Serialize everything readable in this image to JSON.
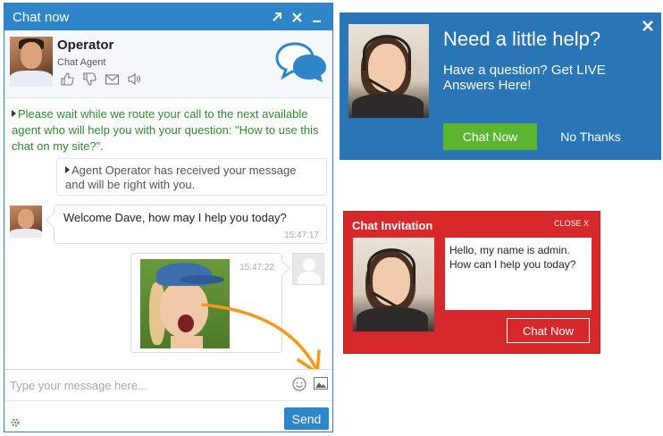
{
  "chat_window": {
    "title": "Chat now",
    "controls": {
      "popout_icon": "arrow-up-right-icon",
      "close_icon": "close-icon",
      "minimize_icon": "minimize-icon"
    },
    "operator": {
      "name": "Operator",
      "role": "Chat Agent",
      "actions": [
        "thumbs-up-icon",
        "thumbs-down-icon",
        "envelope-icon",
        "speaker-icon"
      ],
      "brand_icon": "chat-bubbles-icon"
    },
    "messages": {
      "system_wait": "Please wait while we route your call to the next available agent who will help you with your question: \"How to use this chat on my site?\".",
      "system_received": "Agent Operator has received your message and will be right with you.",
      "operator_greeting": {
        "text": "Welcome Dave, how may I help you today?",
        "time": "15:47:17"
      },
      "user_image": {
        "time": "15:47:22"
      }
    },
    "composer": {
      "placeholder": "Type your message here...",
      "send_label": "Send"
    },
    "colors": {
      "accent": "#2e86c9",
      "system_text": "#2f8a2f",
      "annotation_arrow": "#f39a1e"
    }
  },
  "help_banner": {
    "heading": "Need a little help?",
    "subtext": "Have a question? Get LIVE Answers Here!",
    "chat_button": "Chat Now",
    "no_thanks_button": "No Thanks",
    "colors": {
      "background": "#2a75b6",
      "chat_button": "#5cb52e"
    }
  },
  "invitation": {
    "title": "Chat Invitation",
    "close_label": "CLOSE X",
    "message": "Hello, my name is admin. How can I help you today?",
    "chat_button": "Chat Now",
    "colors": {
      "background": "#d7282c"
    }
  }
}
